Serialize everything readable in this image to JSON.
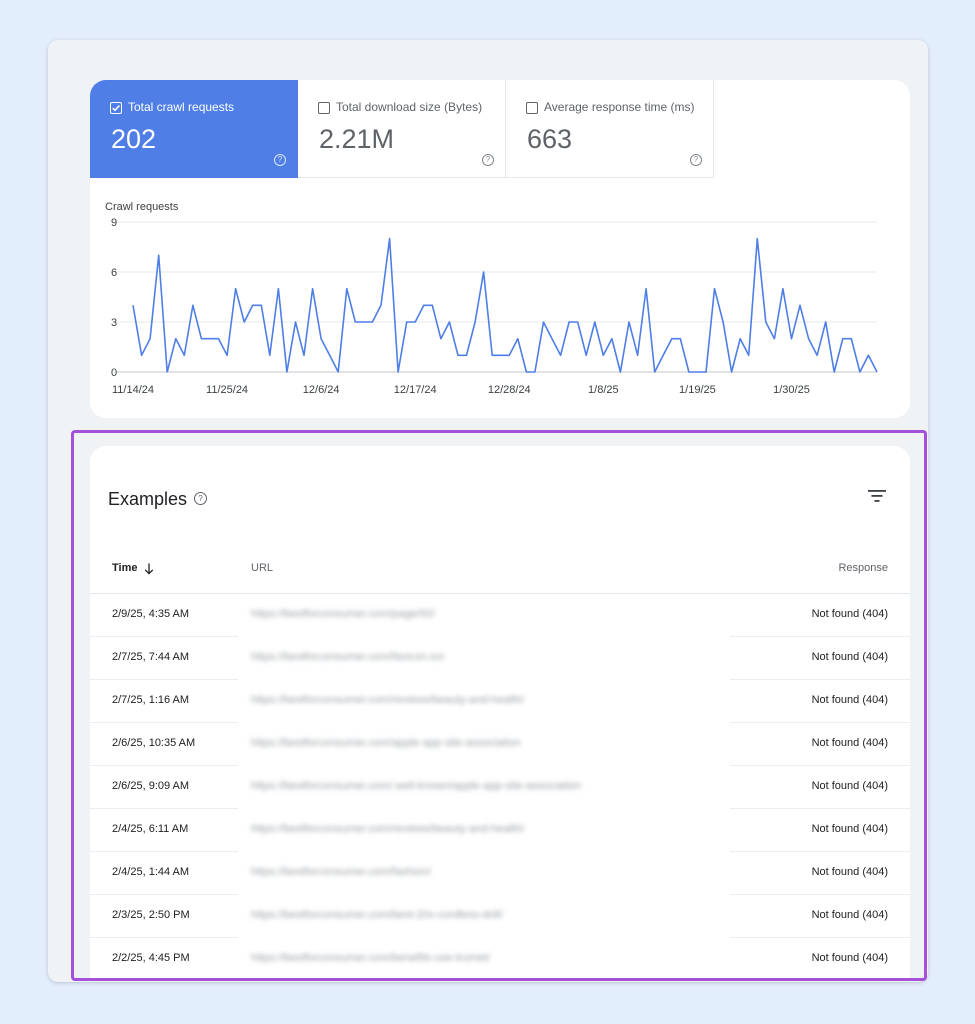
{
  "metrics": [
    {
      "label": "Total crawl requests",
      "value": "202",
      "checked": true
    },
    {
      "label": "Total download size (Bytes)",
      "value": "2.21M",
      "checked": false
    },
    {
      "label": "Average response time (ms)",
      "value": "663",
      "checked": false
    }
  ],
  "help_glyph": "?",
  "chart_data": {
    "type": "line",
    "title": "Crawl requests",
    "y_ticks": [
      0,
      3,
      6,
      9
    ],
    "ylim": [
      0,
      9
    ],
    "x_ticks": [
      "11/14/24",
      "11/25/24",
      "12/6/24",
      "12/17/24",
      "12/28/24",
      "1/8/25",
      "1/19/25",
      "1/30/25"
    ],
    "x_tick_index": [
      0,
      11,
      22,
      33,
      44,
      55,
      66,
      77
    ],
    "grid": true,
    "series": [
      {
        "color": "#4e7ee6",
        "values": [
          4,
          1,
          2,
          7,
          0,
          2,
          1,
          4,
          2,
          2,
          2,
          1,
          5,
          3,
          4,
          4,
          1,
          5,
          0,
          3,
          1,
          5,
          2,
          1,
          0,
          5,
          3,
          3,
          3,
          4,
          8,
          0,
          3,
          3,
          4,
          4,
          2,
          3,
          1,
          1,
          3,
          6,
          1,
          1,
          1,
          2,
          0,
          0,
          3,
          2,
          1,
          3,
          3,
          1,
          3,
          1,
          2,
          0,
          3,
          1,
          5,
          0,
          1,
          2,
          2,
          0,
          0,
          0,
          5,
          3,
          0,
          2,
          1,
          8,
          3,
          2,
          5,
          2,
          4,
          2,
          1,
          3,
          0,
          2,
          2,
          0,
          1,
          0
        ]
      }
    ]
  },
  "examples": {
    "title": "Examples",
    "columns": {
      "time": "Time",
      "url": "URL",
      "response": "Response"
    },
    "rows": [
      {
        "time": "2/9/25, 4:35 AM",
        "url": "https://bestforconsumer.com/page/92/",
        "response": "Not found (404)"
      },
      {
        "time": "2/7/25, 7:44 AM",
        "url": "https://bestforconsumer.com/favicon.ico",
        "response": "Not found (404)"
      },
      {
        "time": "2/7/25, 1:16 AM",
        "url": "https://bestforconsumer.com/reviews/beauty-and-health/",
        "response": "Not found (404)"
      },
      {
        "time": "2/6/25, 10:35 AM",
        "url": "https://bestforconsumer.com/apple-app-site-association",
        "response": "Not found (404)"
      },
      {
        "time": "2/6/25, 9:09 AM",
        "url": "https://bestforconsumer.com/.well-known/apple-app-site-association",
        "response": "Not found (404)"
      },
      {
        "time": "2/4/25, 6:11 AM",
        "url": "https://bestforconsumer.com/reviews/beauty-and-health/",
        "response": "Not found (404)"
      },
      {
        "time": "2/4/25, 1:44 AM",
        "url": "https://bestforconsumer.com/fashion/",
        "response": "Not found (404)"
      },
      {
        "time": "2/3/25, 2:50 PM",
        "url": "https://bestforconsumer.com/best-20v-cordless-drill/",
        "response": "Not found (404)"
      },
      {
        "time": "2/2/25, 4:45 PM",
        "url": "https://bestforconsumer.com/benefits-use-trumet/",
        "response": "Not found (404)"
      }
    ]
  },
  "colors": {
    "accent": "#4e7ee6",
    "highlight": "#a650da",
    "background": "#e3eefd"
  }
}
